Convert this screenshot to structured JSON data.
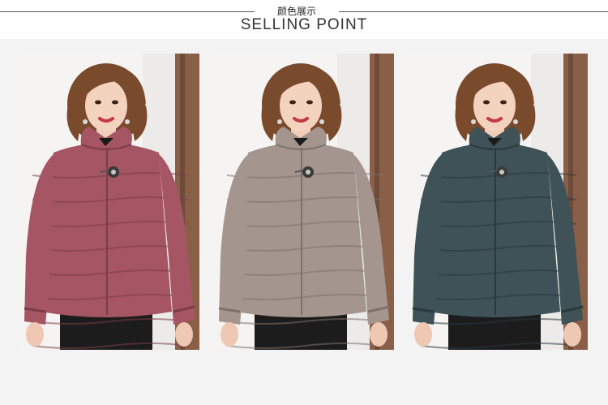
{
  "header": {
    "title_cn": "颜色展示",
    "title_en": "SELLING POINT"
  },
  "products": [
    {
      "color_name": "rose-pink",
      "coat_color": "#a55563",
      "coat_dark": "#7e3c48"
    },
    {
      "color_name": "taupe-grey",
      "coat_color": "#a5958f",
      "coat_dark": "#7e716c"
    },
    {
      "color_name": "dark-teal",
      "coat_color": "#3e5257",
      "coat_dark": "#2a393d"
    }
  ]
}
